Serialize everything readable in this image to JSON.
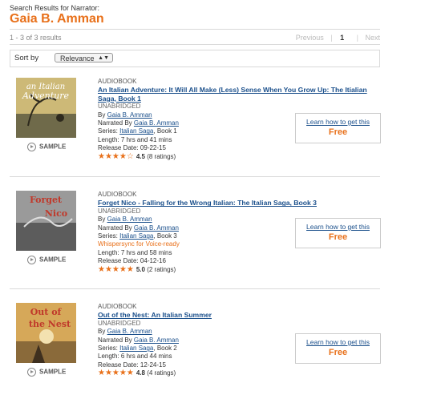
{
  "header": {
    "label": "Search Results for Narrator:",
    "narrator": "Gaia B. Amman"
  },
  "pagination": {
    "count_text": "1 - 3 of 3 results",
    "previous": "Previous",
    "separator": "|",
    "current_page": "1",
    "next": "Next"
  },
  "sort": {
    "label": "Sort by",
    "selected": "Relevance"
  },
  "results": [
    {
      "category": "AUDIOBOOK",
      "title": "An Italian Adventure: It Will All Make (Less) Sense When You Grow Up: The Itialian Saga, Book 1",
      "format": "UNABRIDGED",
      "by_label": "By ",
      "author": "Gaia B. Amman",
      "narrated_label": "Narrated By ",
      "narrator": "Gaia B. Amman",
      "series_label": "Series: ",
      "series": "Italian Saga",
      "series_book": ", Book 1",
      "whispersync": "",
      "length": "Length: 7 hrs and 41 mins",
      "release": "Release Date: 09-22-15",
      "stars": "★★★★☆",
      "rating_value": "4.5",
      "rating_count": "(8 ratings)",
      "sample": "SAMPLE",
      "learn": "Learn how to get this",
      "price": "Free",
      "cover_text": "an Italian Adventure",
      "cover_color": "#c9b46a"
    },
    {
      "category": "AUDIOBOOK",
      "title": "Forget Nico - Falling for the Wrong Italian: The Italian Saga, Book 3",
      "format": "UNABRIDGED",
      "by_label": "By ",
      "author": "Gaia B. Amman",
      "narrated_label": "Narrated By ",
      "narrator": "Gaia B. Amman",
      "series_label": "Series: ",
      "series": "Italian Saga",
      "series_book": ", Book 3",
      "whispersync": "Whispersync for Voice-ready",
      "length": "Length: 7 hrs and 58 mins",
      "release": "Release Date: 04-12-16",
      "stars": "★★★★★",
      "rating_value": "5.0",
      "rating_count": "(2 ratings)",
      "sample": "SAMPLE",
      "learn": "Learn how to get this",
      "price": "Free",
      "cover_text": "Forget Nico",
      "cover_color": "#8a8a8a"
    },
    {
      "category": "AUDIOBOOK",
      "title": "Out of the Nest: An Italian Summer",
      "format": "UNABRIDGED",
      "by_label": "By ",
      "author": "Gaia B. Amman",
      "narrated_label": "Narrated By ",
      "narrator": "Gaia B. Amman",
      "series_label": "Series: ",
      "series": "Italian Saga",
      "series_book": ", Book 2",
      "whispersync": "",
      "length": "Length: 6 hrs and 44 mins",
      "release": "Release Date: 12-24-15",
      "stars": "★★★★★",
      "rating_value": "4.8",
      "rating_count": "(4 ratings)",
      "sample": "SAMPLE",
      "learn": "Learn how to get this",
      "price": "Free",
      "cover_text": "Out of the Nest",
      "cover_color": "#d2a24c"
    }
  ],
  "colors": {
    "accent": "#e8701a",
    "link": "#1a4f8b"
  }
}
